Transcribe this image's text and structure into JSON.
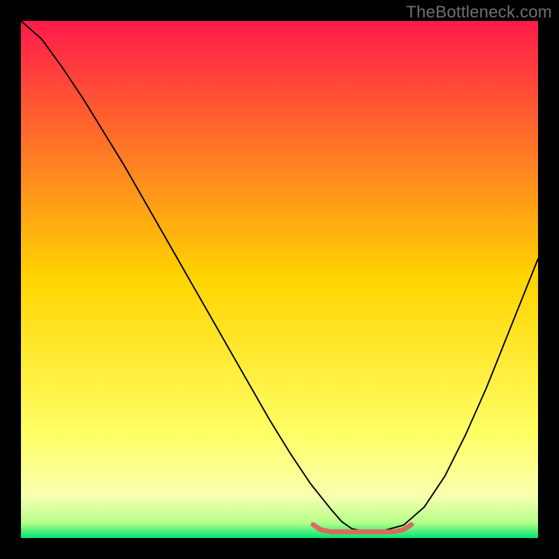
{
  "watermark": "TheBottleneck.com",
  "chart_data": {
    "type": "line",
    "title": "",
    "xlabel": "",
    "ylabel": "",
    "xlim": [
      0,
      100
    ],
    "ylim": [
      0,
      100
    ],
    "grid": false,
    "legend": false,
    "background_gradient": {
      "stops": [
        {
          "offset": 0.0,
          "color": "#ff1a4b"
        },
        {
          "offset": 0.5,
          "color": "#ffd500"
        },
        {
          "offset": 0.8,
          "color": "#ffff66"
        },
        {
          "offset": 0.92,
          "color": "#f7ffb0"
        },
        {
          "offset": 0.97,
          "color": "#b6ff8a"
        },
        {
          "offset": 1.0,
          "color": "#00e572"
        }
      ]
    },
    "series": [
      {
        "name": "bottleneck-curve",
        "color": "#000000",
        "stroke_width": 2,
        "x": [
          0,
          4,
          8,
          12,
          16,
          20,
          24,
          28,
          32,
          36,
          40,
          44,
          48,
          52,
          56,
          60,
          62,
          64,
          66,
          70,
          74,
          78,
          82,
          86,
          90,
          94,
          98,
          100
        ],
        "y": [
          100,
          96.5,
          91,
          85,
          78.5,
          72,
          65,
          58,
          51,
          44,
          37,
          30,
          23,
          16.5,
          10.5,
          5.5,
          3.2,
          1.8,
          1.4,
          1.4,
          2.5,
          6,
          12,
          20,
          29,
          39,
          49,
          54
        ]
      },
      {
        "name": "optimal-zone-marker",
        "color": "#d96a5e",
        "stroke_width": 7,
        "x": [
          56.5,
          58,
          60,
          64,
          68,
          72,
          74,
          75.5
        ],
        "y": [
          2.6,
          1.6,
          1.2,
          1.2,
          1.2,
          1.2,
          1.6,
          2.6
        ]
      }
    ]
  }
}
